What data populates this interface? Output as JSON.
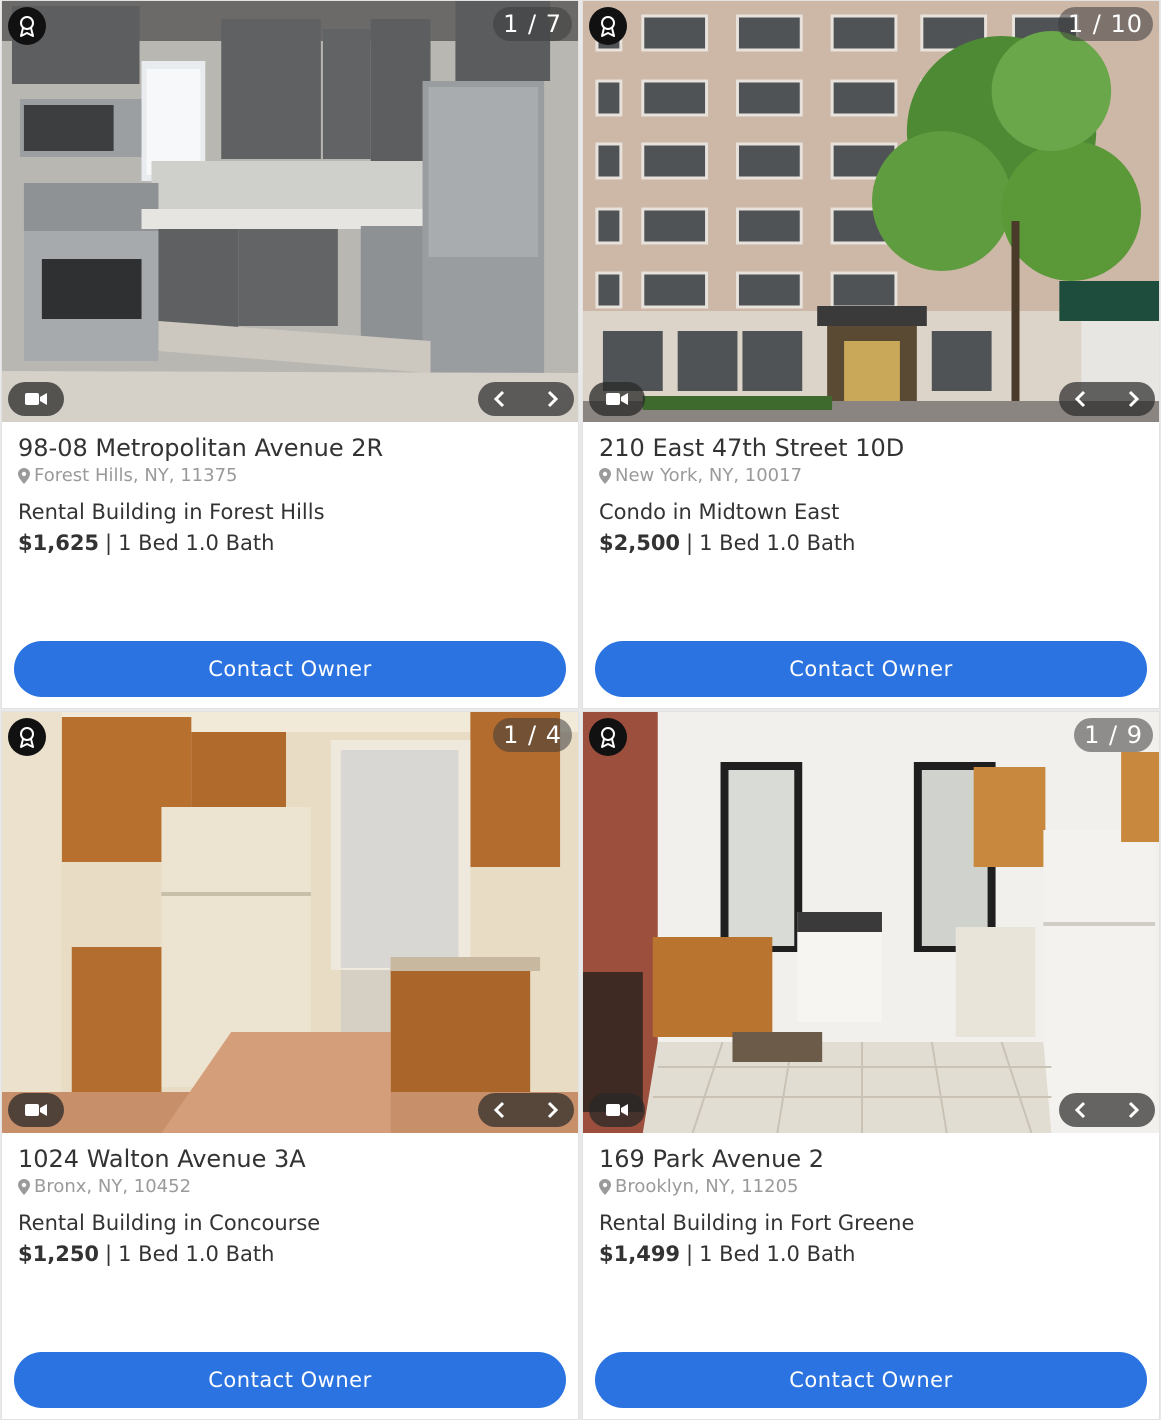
{
  "listings": [
    {
      "counter": "1 / 7",
      "address": "98-08 Metropolitan Avenue 2R",
      "location": "Forest Hills, NY, 11375",
      "description": "Rental Building in Forest Hills",
      "price": "$1,625",
      "separator": "|",
      "beds_baths": "1 Bed 1.0 Bath",
      "contact_label": "Contact Owner",
      "photo": "kitchen-gray-cabinets"
    },
    {
      "counter": "1 / 10",
      "address": "210 East 47th Street 10D",
      "location": "New York, NY, 10017",
      "description": "Condo in Midtown East",
      "price": "$2,500",
      "separator": "|",
      "beds_baths": "1 Bed 1.0 Bath",
      "contact_label": "Contact Owner",
      "photo": "brick-building-exterior"
    },
    {
      "counter": "1 / 4",
      "address": "1024 Walton Avenue 3A",
      "location": "Bronx, NY, 10452",
      "description": "Rental Building in Concourse",
      "price": "$1,250",
      "separator": "|",
      "beds_baths": "1 Bed 1.0 Bath",
      "contact_label": "Contact Owner",
      "photo": "kitchen-wood-cabinets"
    },
    {
      "counter": "1 / 9",
      "address": "169 Park Avenue 2",
      "location": "Brooklyn, NY, 11205",
      "description": "Rental Building in Fort Greene",
      "price": "$1,499",
      "separator": "|",
      "beds_baths": "1 Bed 1.0 Bath",
      "contact_label": "Contact Owner",
      "photo": "kitchen-brick-wall"
    }
  ],
  "icons": {
    "badge": "award-ribbon-icon",
    "video": "video-camera-icon",
    "prev": "chevron-left-icon",
    "next": "chevron-right-icon",
    "location": "map-pin-icon"
  },
  "colors": {
    "contact_button": "#2b73e0",
    "location_text": "#9a9a9a"
  }
}
